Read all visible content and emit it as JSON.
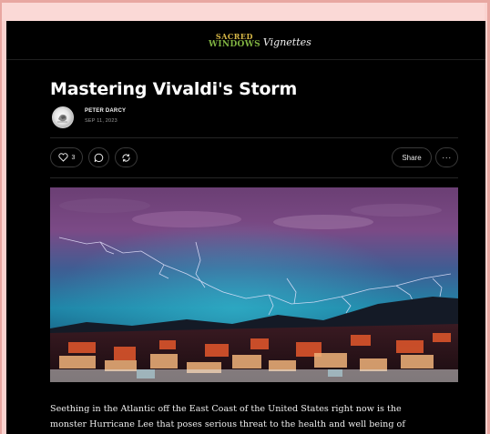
{
  "site": {
    "logo_line1": "SACRED",
    "logo_line2": "WINDOWS",
    "logo_script": "Vignettes"
  },
  "post": {
    "title": "Mastering Vivaldi's Storm",
    "author": "PETER DARCY",
    "date": "SEP 11, 2023",
    "like_count": "3",
    "share_label": "Share",
    "more_label": "···",
    "hero_image": "lightning storm over city at dusk",
    "body_line1": "Seething in the Atlantic off the East Coast of the United States right now is the",
    "body_line2": "monster Hurricane Lee that poses serious threat to the health and well being of"
  },
  "icons": {
    "like": "heart-icon",
    "comment": "comment-icon",
    "restack": "restack-icon",
    "more": "ellipsis-icon"
  },
  "colors": {
    "page_background": "#000000",
    "frame": "#fad2cf",
    "logo_gold": "#d8b847",
    "logo_green": "#7fb241",
    "text": "#ffffff"
  }
}
